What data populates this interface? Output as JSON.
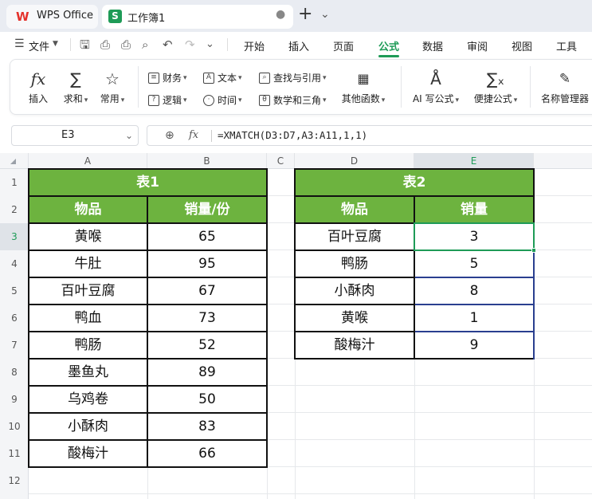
{
  "titlebar": {
    "app_tab": "WPS Office",
    "workbook_tab": "工作簿1",
    "new_tab": "+",
    "dropdown": "⌄"
  },
  "menubar": {
    "file": "文件",
    "items": [
      "开始",
      "插入",
      "页面",
      "公式",
      "数据",
      "审阅",
      "视图",
      "工具"
    ],
    "active": "公式"
  },
  "ribbon": {
    "insert": "插入",
    "sum": "求和",
    "common": "常用",
    "finance": "财务",
    "text": "文本",
    "lookup": "查找与引用",
    "logic": "逻辑",
    "time": "时间",
    "math": "数学和三角",
    "other": "其他函数",
    "ai_formula": "AI 写公式",
    "quick_formula": "便捷公式",
    "name_manager": "名称管理器"
  },
  "formula_bar": {
    "cell_ref": "E3",
    "fx": "fx",
    "formula": "=XMATCH(D3:D7,A3:A11,1,1)"
  },
  "sheet": {
    "columns": [
      "A",
      "B",
      "C",
      "D",
      "E"
    ],
    "selected_column": "E",
    "selected_row": "3",
    "rows": [
      "1",
      "2",
      "3",
      "4",
      "5",
      "6",
      "7",
      "8",
      "9",
      "10",
      "11",
      "12"
    ],
    "table1": {
      "title": "表1",
      "headers": [
        "物品",
        "销量/份"
      ],
      "rows": [
        [
          "黄喉",
          "65"
        ],
        [
          "牛肚",
          "95"
        ],
        [
          "百叶豆腐",
          "67"
        ],
        [
          "鸭血",
          "73"
        ],
        [
          "鸭肠",
          "52"
        ],
        [
          "墨鱼丸",
          "89"
        ],
        [
          "乌鸡卷",
          "50"
        ],
        [
          "小酥肉",
          "83"
        ],
        [
          "酸梅汁",
          "66"
        ]
      ]
    },
    "table2": {
      "title": "表2",
      "headers": [
        "物品",
        "销量"
      ],
      "rows": [
        [
          "百叶豆腐",
          "3"
        ],
        [
          "鸭肠",
          "5"
        ],
        [
          "小酥肉",
          "8"
        ],
        [
          "黄喉",
          "1"
        ],
        [
          "酸梅汁",
          "9"
        ]
      ]
    }
  },
  "colors": {
    "accent": "#1e9b57",
    "header_fill": "#6db33f"
  }
}
